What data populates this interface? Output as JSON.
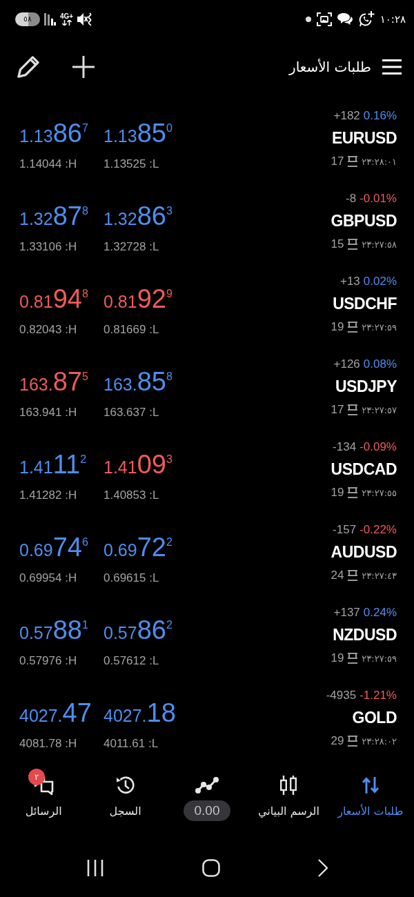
{
  "status_bar": {
    "battery": "٥٨",
    "network": "4G+",
    "time": "١٠:٢٨"
  },
  "header": {
    "title": "طلبات الأسعار"
  },
  "quotes": [
    {
      "symbol": "EURUSD",
      "change_points": "+182",
      "change_percent": "0.16%",
      "change_rising": true,
      "spread": "17",
      "time": "٢٣:٢٨:٠١",
      "prices": [
        {
          "lead": "1.13",
          "big": "86",
          "tail": "7",
          "rising": true,
          "extreme": "1.14044 :H"
        },
        {
          "lead": "1.13",
          "big": "85",
          "tail": "0",
          "rising": true,
          "extreme": "1.13525 :L"
        }
      ]
    },
    {
      "symbol": "GBPUSD",
      "change_points": "-8",
      "change_percent": "-0.01%",
      "change_rising": false,
      "spread": "15",
      "time": "٢٣:٢٧:٥٨",
      "prices": [
        {
          "lead": "1.32",
          "big": "87",
          "tail": "8",
          "rising": true,
          "extreme": "1.33106 :H"
        },
        {
          "lead": "1.32",
          "big": "86",
          "tail": "3",
          "rising": true,
          "extreme": "1.32728 :L"
        }
      ]
    },
    {
      "symbol": "USDCHF",
      "change_points": "+13",
      "change_percent": "0.02%",
      "change_rising": true,
      "spread": "19",
      "time": "٢٣:٢٧:٥٩",
      "prices": [
        {
          "lead": "0.81",
          "big": "94",
          "tail": "8",
          "rising": false,
          "extreme": "0.82043 :H"
        },
        {
          "lead": "0.81",
          "big": "92",
          "tail": "9",
          "rising": false,
          "extreme": "0.81669 :L"
        }
      ]
    },
    {
      "symbol": "USDJPY",
      "change_points": "+126",
      "change_percent": "0.08%",
      "change_rising": true,
      "spread": "17",
      "time": "٢٣:٢٧:٥٧",
      "prices": [
        {
          "lead": "163.",
          "big": "87",
          "tail": "5",
          "rising": false,
          "extreme": "163.941 :H"
        },
        {
          "lead": "163.",
          "big": "85",
          "tail": "8",
          "rising": true,
          "extreme": "163.637 :L"
        }
      ]
    },
    {
      "symbol": "USDCAD",
      "change_points": "-134",
      "change_percent": "-0.09%",
      "change_rising": false,
      "spread": "19",
      "time": "٢٣:٢٧:٥٥",
      "prices": [
        {
          "lead": "1.41",
          "big": "11",
          "tail": "2",
          "rising": true,
          "extreme": "1.41282 :H"
        },
        {
          "lead": "1.41",
          "big": "09",
          "tail": "3",
          "rising": false,
          "extreme": "1.40853 :L"
        }
      ]
    },
    {
      "symbol": "AUDUSD",
      "change_points": "-157",
      "change_percent": "-0.22%",
      "change_rising": false,
      "spread": "24",
      "time": "٢٣:٢٧:٤٣",
      "prices": [
        {
          "lead": "0.69",
          "big": "74",
          "tail": "6",
          "rising": true,
          "extreme": "0.69954 :H"
        },
        {
          "lead": "0.69",
          "big": "72",
          "tail": "2",
          "rising": true,
          "extreme": "0.69615 :L"
        }
      ]
    },
    {
      "symbol": "NZDUSD",
      "change_points": "+137",
      "change_percent": "0.24%",
      "change_rising": true,
      "spread": "19",
      "time": "٢٣:٢٧:٥٩",
      "prices": [
        {
          "lead": "0.57",
          "big": "88",
          "tail": "1",
          "rising": true,
          "extreme": "0.57976 :H"
        },
        {
          "lead": "0.57",
          "big": "86",
          "tail": "2",
          "rising": true,
          "extreme": "0.57612 :L"
        }
      ]
    },
    {
      "symbol": "GOLD",
      "change_points": "-4935",
      "change_percent": "-1.21%",
      "change_rising": false,
      "spread": "29",
      "time": "٢٣:٢٨:٠٢",
      "prices": [
        {
          "lead": "4027.",
          "big": "47",
          "rising": true,
          "extreme": "4081.78 :H"
        },
        {
          "lead": "4027.",
          "big": "18",
          "rising": true,
          "extreme": "4011.61 :L"
        }
      ]
    }
  ],
  "bottom_nav": [
    {
      "kind": "quotes",
      "label": "طلبات الأسعار",
      "selected": true
    },
    {
      "kind": "chart",
      "label": "الرسم البياني",
      "selected": false
    },
    {
      "kind": "trade",
      "label": "0.00",
      "selected": false
    },
    {
      "kind": "history",
      "label": "السجل",
      "selected": false
    },
    {
      "kind": "messages",
      "label": "الرسائل",
      "selected": false,
      "badge": "٢"
    }
  ]
}
